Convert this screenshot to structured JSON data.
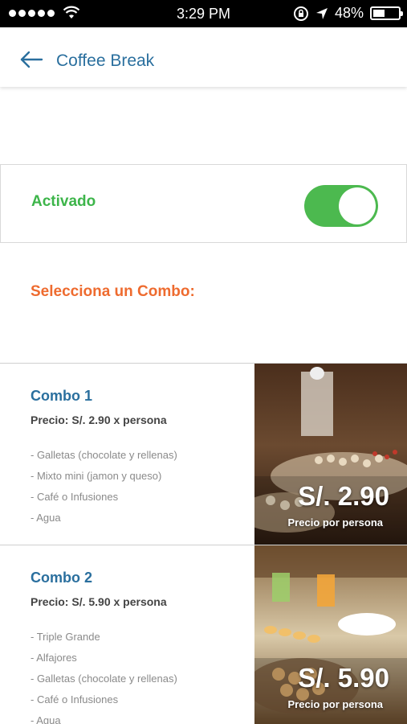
{
  "status_bar": {
    "time": "3:29 PM",
    "battery_percent": "48%",
    "battery_level": 0.48
  },
  "header": {
    "title": "Coffee Break",
    "back_icon": "arrow-left-icon"
  },
  "toggle": {
    "label": "Activado",
    "state": "on",
    "color": "#4cb94f"
  },
  "section_title": "Selecciona un Combo:",
  "colors": {
    "accent_blue": "#2a6f9e",
    "active_green": "#3db54a",
    "section_orange": "#ee6b2f"
  },
  "combos": [
    {
      "name": "Combo 1",
      "price_line": "Precio: S/. 2.90 x persona",
      "items": [
        "- Galletas (chocolate y rellenas)",
        "- Mixto mini (jamon y queso)",
        "- Café o Infusiones",
        "- Agua"
      ],
      "big_price": "S/. 2.90",
      "per_person": "Precio por persona"
    },
    {
      "name": "Combo 2",
      "price_line": "Precio: S/. 5.90 x persona",
      "items": [
        "- Triple Grande",
        "- Alfajores",
        "- Galletas (chocolate y rellenas)",
        "- Café o Infusiones",
        "- Agua"
      ],
      "big_price": "S/. 5.90",
      "per_person": "Precio por persona"
    }
  ]
}
